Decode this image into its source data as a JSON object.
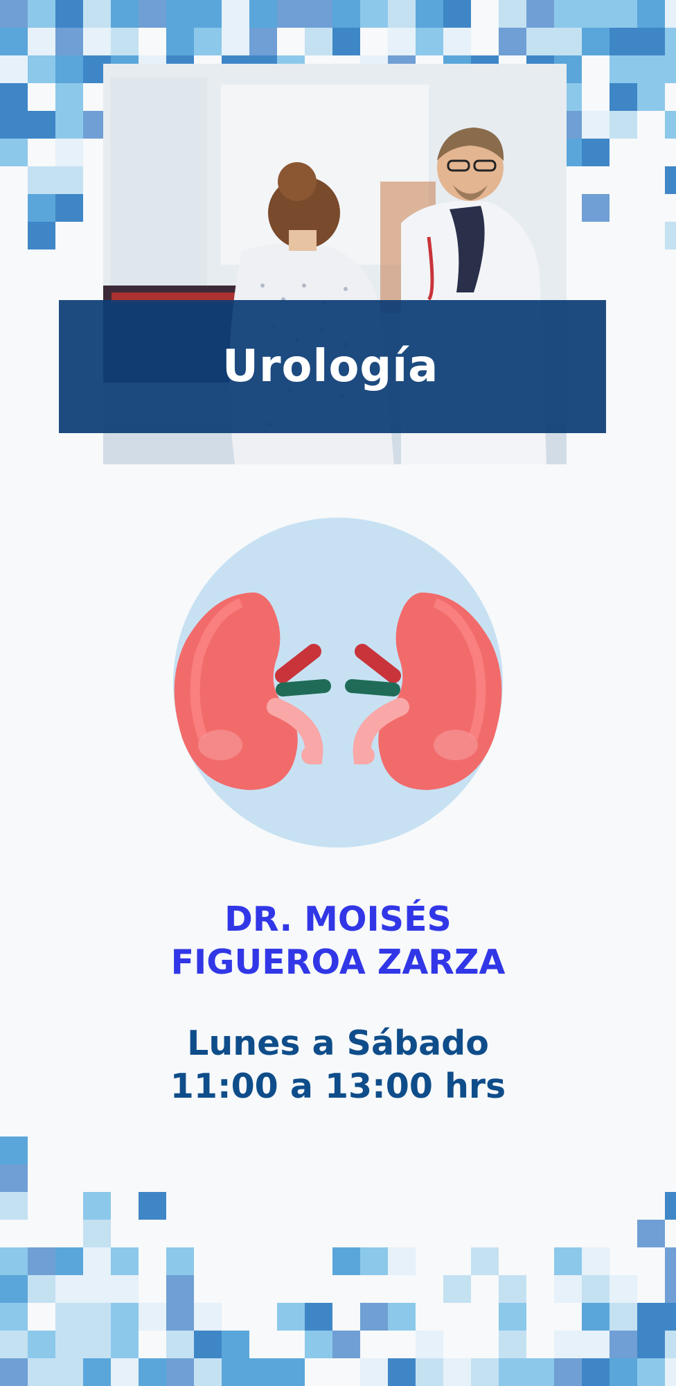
{
  "banner": {
    "title": "Urología"
  },
  "doctor": {
    "line1": "DR. MOISÉS",
    "line2": "FIGUEROA ZARZA"
  },
  "schedule": {
    "days": "Lunes a Sábado",
    "hours": "11:00 a 13:00 hrs"
  },
  "colors": {
    "banner": "#0d3d75",
    "doctor_name": "#3137e6",
    "schedule_text": "#0f4d8a",
    "kidney": "#f26b6b",
    "circle": "#c7e1f3"
  },
  "icons": {
    "illustration": "kidneys-icon"
  }
}
